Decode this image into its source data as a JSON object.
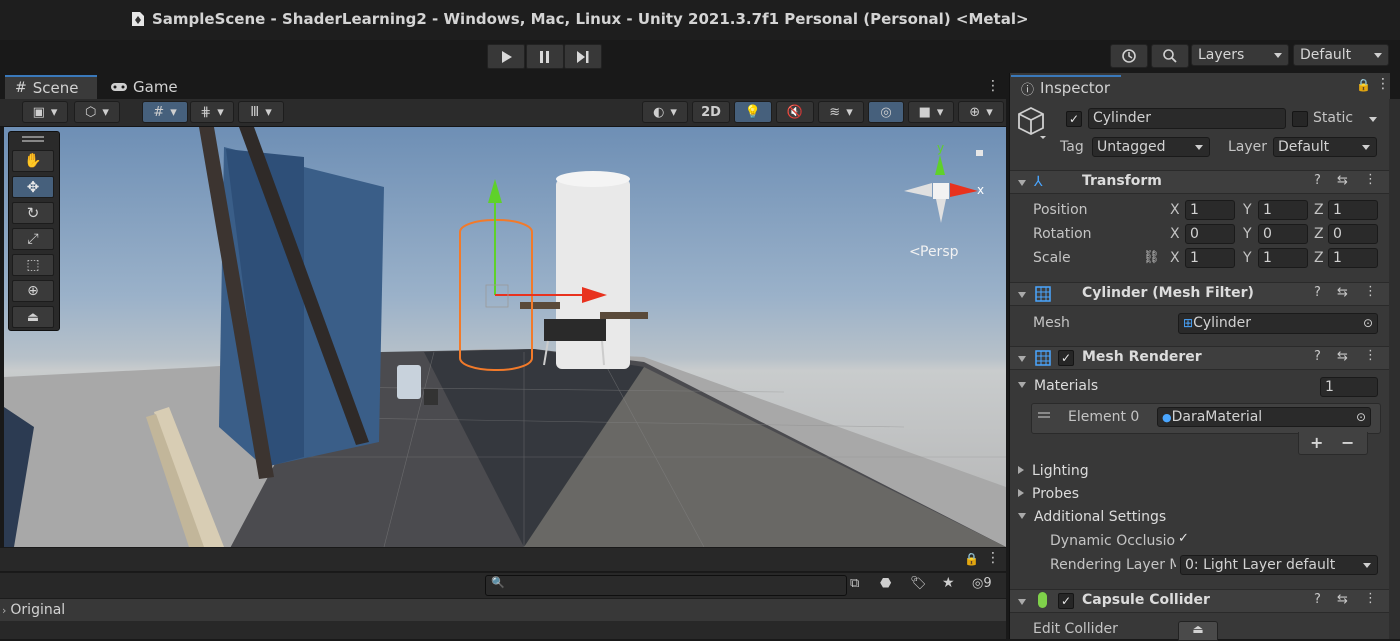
{
  "window": {
    "title": "SampleScene - ShaderLearning2 - Windows, Mac, Linux - Unity 2021.3.7f1 Personal (Personal) <Metal>"
  },
  "toolbar": {
    "play_icon": "play-icon",
    "pause_icon": "pause-icon",
    "step_icon": "step-icon",
    "layers_label": "Layers",
    "layout_label": "Default"
  },
  "scene_tabs": {
    "scene": "Scene",
    "game": "Game"
  },
  "scene_toolbar": {
    "mode_2d": "2D"
  },
  "viewport": {
    "gizmo_y": "y",
    "gizmo_x": "x",
    "projection_label": "Persp"
  },
  "bottom": {
    "hidden_count": "9",
    "tree_root": "Original"
  },
  "inspector": {
    "tab_label": "Inspector",
    "object_name": "Cylinder",
    "static_label": "Static",
    "tag_label": "Tag",
    "tag_value": "Untagged",
    "layer_label": "Layer",
    "layer_value": "Default",
    "transform": {
      "title": "Transform",
      "position_label": "Position",
      "rotation_label": "Rotation",
      "scale_label": "Scale",
      "axis_x": "X",
      "axis_y": "Y",
      "axis_z": "Z",
      "position": [
        "1",
        "1",
        "1"
      ],
      "rotation": [
        "0",
        "0",
        "0"
      ],
      "scale": [
        "1",
        "1",
        "1"
      ]
    },
    "mesh_filter": {
      "title": "Cylinder (Mesh Filter)",
      "mesh_label": "Mesh",
      "mesh_value": "Cylinder"
    },
    "mesh_renderer": {
      "title": "Mesh Renderer",
      "materials_label": "Materials",
      "materials_count": "1",
      "element_label": "Element 0",
      "element_value": "DaraMaterial",
      "add_label": "+",
      "remove_label": "−",
      "lighting_label": "Lighting",
      "probes_label": "Probes",
      "additional_label": "Additional Settings",
      "dynamic_occlusion_label": "Dynamic Occlusioı",
      "rendering_layer_label": "Rendering Layer M",
      "rendering_layer_value": "0: Light Layer default"
    },
    "capsule_collider": {
      "title": "Capsule Collider",
      "edit_collider_label": "Edit Collider"
    }
  },
  "colors": {
    "accent": "#3a79bb",
    "gizmo_red": "#e8321e",
    "gizmo_green": "#5fd12a",
    "selection_orange": "#f27a2a"
  }
}
